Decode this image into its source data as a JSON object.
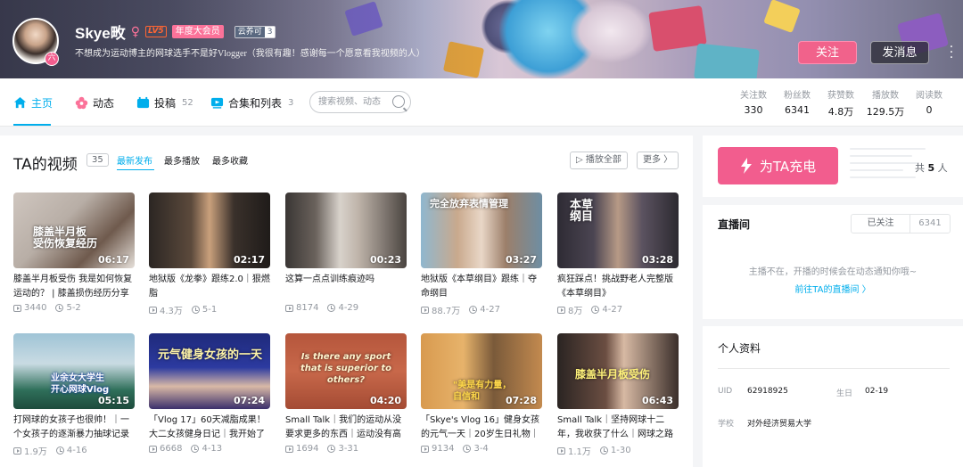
{
  "header": {
    "username": "Skye畋",
    "level": "LV5",
    "vip_label": "年度大会员",
    "medal_name": "云养可",
    "medal_level": "3",
    "signature": "不想成为运动博主的网球选手不是好Vlogger（我很有趣！感谢每一个愿意看我视频的人）",
    "avatar_badge": "六",
    "follow_button": "关注",
    "message_button": "发消息"
  },
  "nav": {
    "home": "主页",
    "dynamic": "动态",
    "posts": "投稿",
    "posts_count": "52",
    "collections": "合集和列表",
    "collections_count": "3",
    "search_placeholder": "搜索视频、动态"
  },
  "stats": [
    {
      "label": "关注数",
      "value": "330"
    },
    {
      "label": "粉丝数",
      "value": "6341"
    },
    {
      "label": "获赞数",
      "value": "4.8万"
    },
    {
      "label": "播放数",
      "value": "129.5万"
    },
    {
      "label": "阅读数",
      "value": "0"
    }
  ],
  "videos_section": {
    "title": "TA的视频",
    "count": "35",
    "sort_latest": "最新发布",
    "sort_most_played": "最多播放",
    "sort_most_fav": "最多收藏",
    "play_all": "播放全部",
    "more": "更多"
  },
  "videos": [
    {
      "duration": "06:17",
      "title": "膝盖半月板受伤 我是如何恢复运动的？ | 膝盖损伤经历分享",
      "views": "3440",
      "date": "5-2",
      "overlay": "膝盖半月板\n受伤恢复经历"
    },
    {
      "duration": "02:17",
      "title": "地狱版《龙拳》跟练2.0｜狠燃脂",
      "views": "4.3万",
      "date": "5-1",
      "overlay": ""
    },
    {
      "duration": "00:23",
      "title": "这算一点点训练痕迹吗",
      "views": "8174",
      "date": "4-29",
      "overlay": ""
    },
    {
      "duration": "03:27",
      "title": "地狱版《本草纲目》跟练｜夺命纲目",
      "views": "88.7万",
      "date": "4-27",
      "overlay": "完全放弃表情管理"
    },
    {
      "duration": "03:28",
      "title": "疯狂踩点！挑战野老人完整版《本草纲目》",
      "views": "8万",
      "date": "4-27",
      "overlay": "本草\n纲目"
    },
    {
      "duration": "05:15",
      "title": "打网球的女孩子也很帅！｜一个女孩子的逐渐暴力抽球记录",
      "views": "1.9万",
      "date": "4-16",
      "overlay": "业余女大学生\n开心网球Vlog"
    },
    {
      "duration": "07:24",
      "title": "「Vlog 17」60天减脂成果！大二女孩健身日记｜我开始了",
      "views": "6668",
      "date": "4-13",
      "overlay": "元气健身女孩的一天"
    },
    {
      "duration": "04:20",
      "title": "Small Talk｜我们的运动从没要求更多的东西｜运动没有高",
      "views": "1694",
      "date": "3-31",
      "overlay": "Is there any sport\nthat is superior to others?"
    },
    {
      "duration": "07:28",
      "title": "「Skye's Vlog 16」健身女孩的元气一天｜20岁生日礼物｜",
      "views": "9134",
      "date": "3-4",
      "overlay": "\"美是有力量，\n自信和"
    },
    {
      "duration": "06:43",
      "title": "Small Talk｜坚持网球十二年，我收获了什么｜网球之路",
      "views": "1.1万",
      "date": "1-30",
      "overlay": "膝盖半月板受伤"
    }
  ],
  "charge": {
    "button": "为TA充电",
    "total_prefix": "共",
    "total_num": "5",
    "total_suffix": "人"
  },
  "live": {
    "title": "直播间",
    "followed": "已关注",
    "followers": "6341",
    "tip": "主播不在，开播的时候会在动态通知你哦~",
    "link": "前往TA的直播间 〉"
  },
  "profile": {
    "title": "个人资料",
    "uid_label": "UID",
    "uid": "62918925",
    "birthday_label": "生日",
    "birthday": "02-19",
    "school_label": "学校",
    "school": "对外经济贸易大学"
  },
  "colors": {
    "accent": "#00aeec",
    "pink": "#f25d8e"
  }
}
